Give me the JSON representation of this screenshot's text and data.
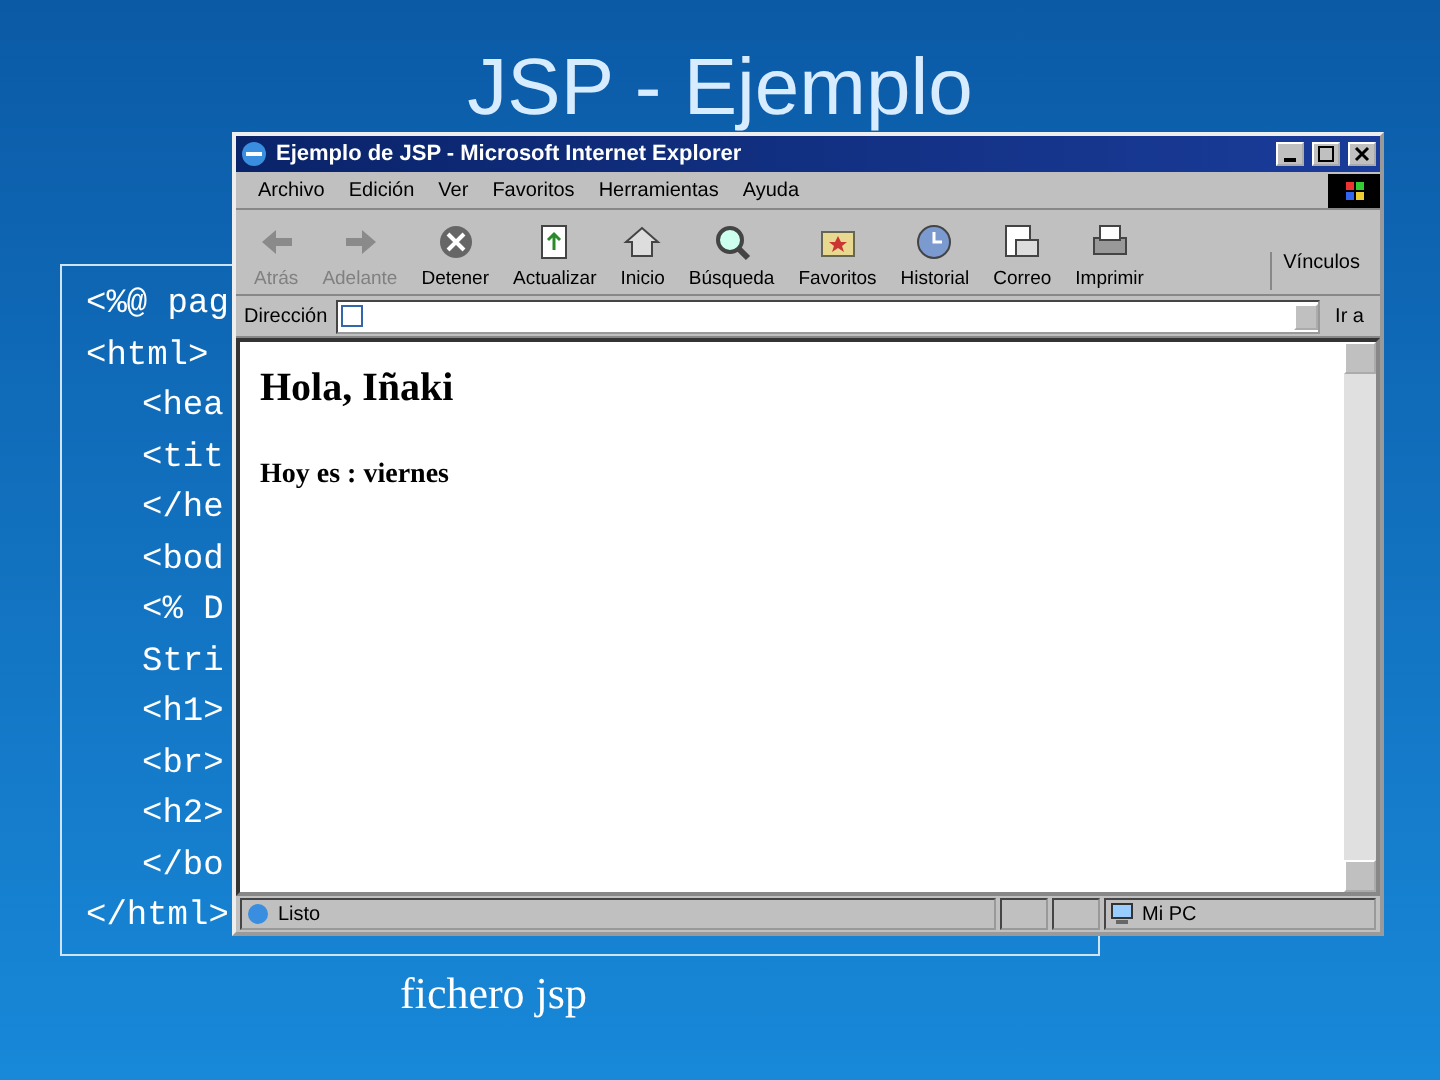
{
  "slide": {
    "title": "JSP - Ejemplo",
    "code_lines": [
      {
        "text": "<%@ pag"
      },
      {
        "text": "<html>",
        "children": [
          {
            "text": "<hea"
          },
          {
            "text": "<tit"
          },
          {
            "text": "</he"
          },
          {
            "text": "<bod"
          },
          {
            "text": "<% D"
          },
          {
            "text": "Stri"
          },
          {
            "text": "<h1>"
          },
          {
            "text": "<br>"
          },
          {
            "text": "<h2>"
          },
          {
            "text": "</bo"
          }
        ]
      },
      {
        "text": "</html>"
      }
    ],
    "caption": "fichero jsp"
  },
  "window": {
    "title": "Ejemplo de JSP - Microsoft Internet Explorer",
    "menu": [
      "Archivo",
      "Edición",
      "Ver",
      "Favoritos",
      "Herramientas",
      "Ayuda"
    ],
    "toolbar": [
      {
        "label": "Atrás",
        "kind": "back",
        "disabled": true
      },
      {
        "label": "Adelante",
        "kind": "forward",
        "disabled": true
      },
      {
        "label": "Detener",
        "kind": "stop",
        "disabled": false
      },
      {
        "label": "Actualizar",
        "kind": "refresh",
        "disabled": false
      },
      {
        "label": "Inicio",
        "kind": "home",
        "disabled": false
      },
      {
        "label": "Búsqueda",
        "kind": "search",
        "disabled": false
      },
      {
        "label": "Favoritos",
        "kind": "favorites",
        "disabled": false
      },
      {
        "label": "Historial",
        "kind": "history",
        "disabled": false
      },
      {
        "label": "Correo",
        "kind": "mail",
        "disabled": false
      },
      {
        "label": "Imprimir",
        "kind": "print",
        "disabled": false
      }
    ],
    "links": "Vínculos",
    "address_label": "Dirección",
    "go": "Ir a",
    "page": {
      "heading": "Hola, Iñaki",
      "subheading": "Hoy es : viernes"
    },
    "status": {
      "text": "Listo",
      "zone": "Mi PC"
    }
  }
}
